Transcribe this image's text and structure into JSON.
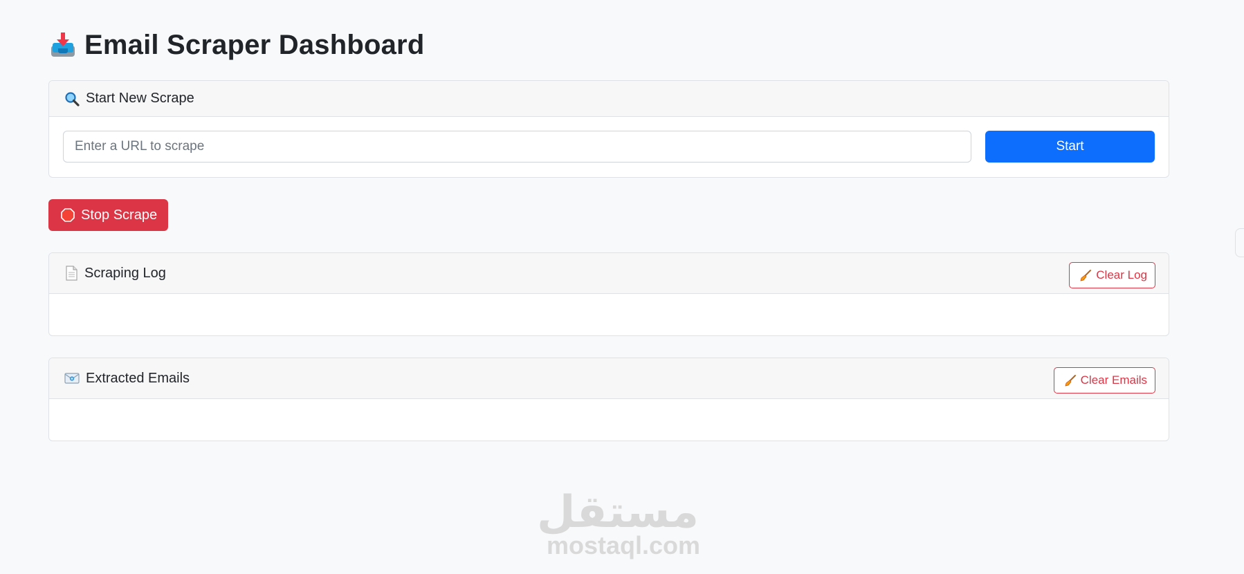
{
  "header": {
    "title": "Email Scraper Dashboard",
    "icon": "inbox-tray-icon"
  },
  "scrape_card": {
    "title": "Start New Scrape",
    "icon": "magnifier-icon",
    "url_input": {
      "value": "",
      "placeholder": "Enter a URL to scrape"
    },
    "start_label": "Start"
  },
  "stop_button": {
    "label": "Stop Scrape",
    "icon": "stop-sign-icon"
  },
  "log_card": {
    "title": "Scraping Log",
    "icon": "document-icon",
    "clear_label": "Clear Log",
    "entries": []
  },
  "emails_card": {
    "title": "Extracted Emails",
    "icon": "envelope-icon",
    "clear_label": "Clear Emails",
    "emails": []
  },
  "watermark": {
    "arabic": "مستقل",
    "latin": "mostaql.com"
  },
  "colors": {
    "primary": "#0d6efd",
    "danger": "#dc3545",
    "background": "#f8f9fa",
    "card_header": "#f7f7f7",
    "border": "#dee2e6"
  }
}
